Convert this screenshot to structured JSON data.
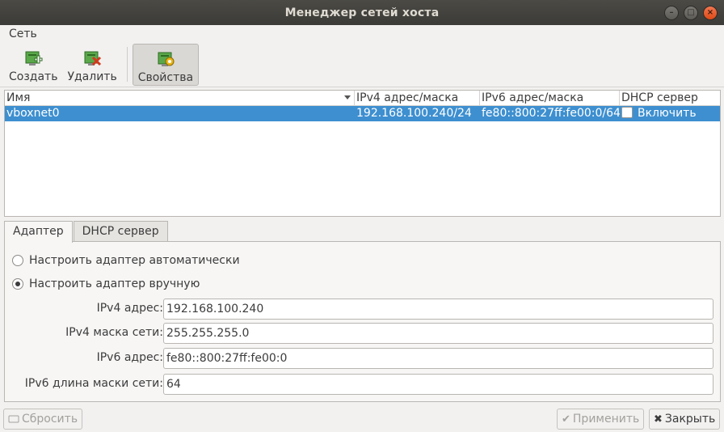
{
  "window": {
    "title": "Менеджер сетей хоста",
    "buttons": {
      "minimize": "–",
      "maximize": "□",
      "close": "×"
    }
  },
  "menubar": {
    "items": [
      {
        "label": "Сеть"
      }
    ]
  },
  "toolbar": {
    "create_label": "Создать",
    "remove_label": "Удалить",
    "properties_label": "Свойства"
  },
  "table": {
    "columns": [
      "Имя",
      "IPv4 адрес/маска",
      "IPv6 адрес/маска",
      "DHCP сервер"
    ],
    "rows": [
      {
        "name": "vboxnet0",
        "ipv4": "192.168.100.240/24",
        "ipv6": "fe80::800:27ff:fe00:0/64",
        "dhcp_label": "Включить",
        "dhcp_checked": false,
        "selected": true
      }
    ]
  },
  "tabs": {
    "adapter": "Адаптер",
    "dhcp": "DHCP сервер",
    "active": "adapter"
  },
  "adapter": {
    "auto_label": "Настроить адаптер автоматически",
    "manual_label": "Настроить адаптер вручную",
    "mode": "manual",
    "ipv4_address_label": "IPv4 адрес:",
    "ipv4_address": "192.168.100.240",
    "ipv4_mask_label": "IPv4 маска сети:",
    "ipv4_mask": "255.255.255.0",
    "ipv6_address_label": "IPv6 адрес:",
    "ipv6_address": "fe80::800:27ff:fe00:0",
    "ipv6_prefix_label": "IPv6 длина маски сети:",
    "ipv6_prefix": "64"
  },
  "buttons": {
    "reset_label": "Сбросить",
    "apply_label": "Применить",
    "close_label": "Закрыть"
  },
  "colors": {
    "selection": "#3d8fd0",
    "titlebar": "#3c3b37",
    "close_button": "#df4a16"
  }
}
